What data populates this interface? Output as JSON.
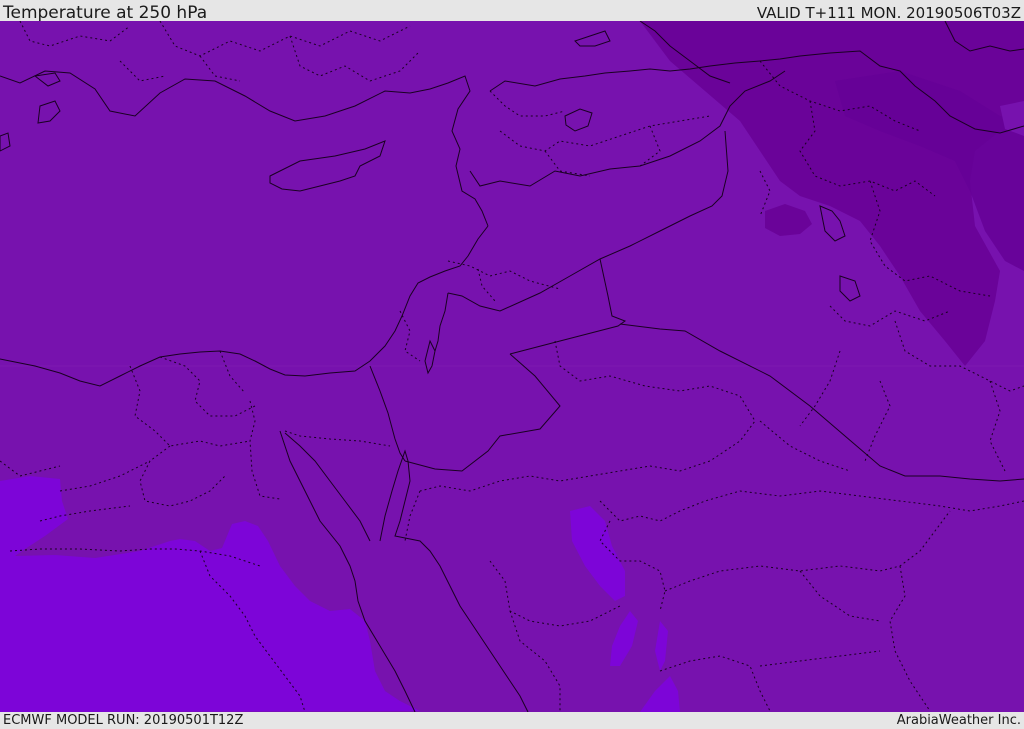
{
  "header": {
    "title": "Temperature at 250 hPa",
    "valid_time": "VALID T+111 MON. 20190506T03Z"
  },
  "footer": {
    "model_run": "ECMWF MODEL RUN: 20190501T12Z",
    "credit": "ArabiaWeather Inc."
  },
  "map": {
    "colors": {
      "base_purple": "#7712ae",
      "dark_purple": "#6a0399",
      "darker_purple": "#650196",
      "light_violet": "#7d05d8",
      "boundary_line": "#1a0022"
    }
  }
}
